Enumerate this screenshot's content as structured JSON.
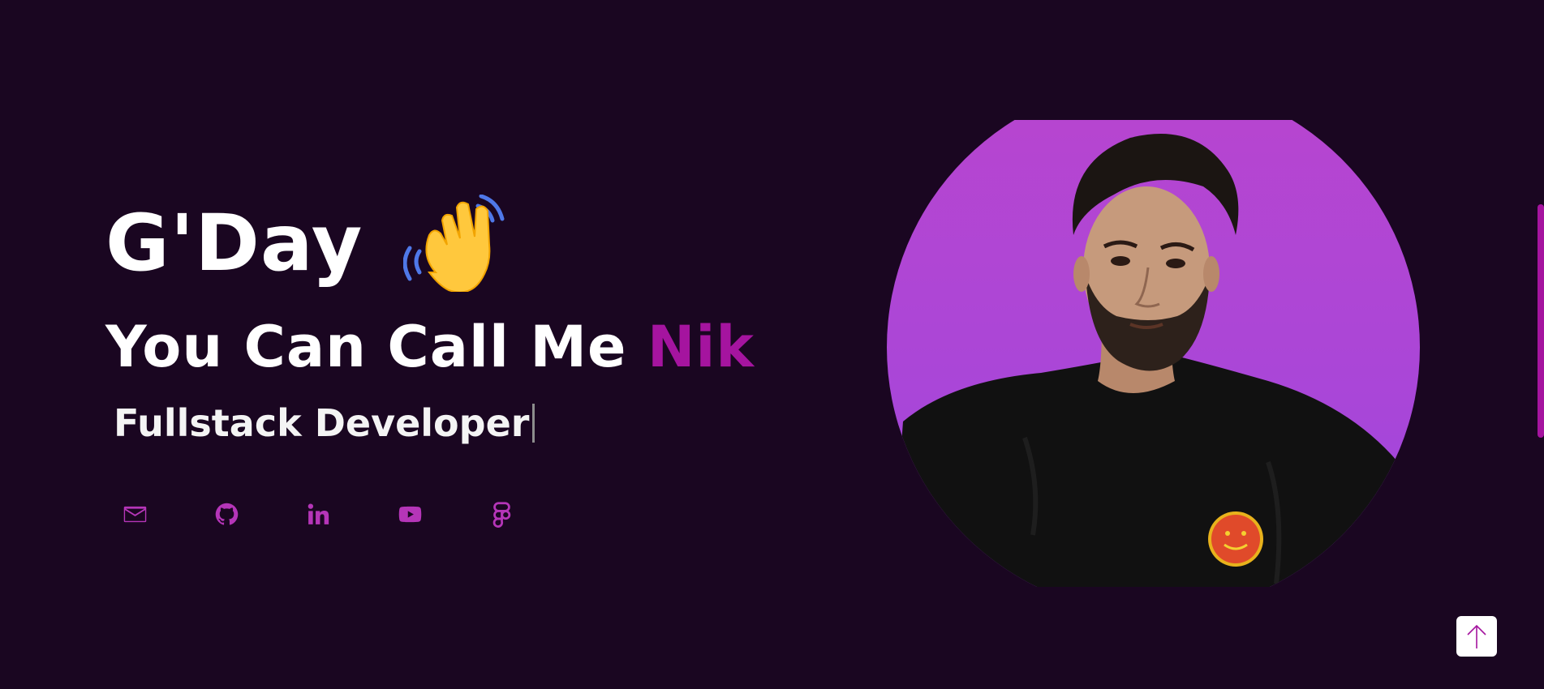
{
  "hero": {
    "greeting": "G'Day",
    "wave_emoji": "waving-hand",
    "intro_prefix": "You Can Call Me ",
    "intro_name": "Nik",
    "role": "Fullstack Developer"
  },
  "socials": [
    {
      "icon": "mail-icon"
    },
    {
      "icon": "github-icon"
    },
    {
      "icon": "linkedin-icon"
    },
    {
      "icon": "youtube-icon"
    },
    {
      "icon": "figma-icon"
    }
  ],
  "colors": {
    "background": "#1a0621",
    "accent": "#a5149f",
    "text": "#ffffff",
    "portrait_bg": "#b845cf"
  },
  "scroll_to_top": {
    "icon": "arrow-up-icon"
  }
}
